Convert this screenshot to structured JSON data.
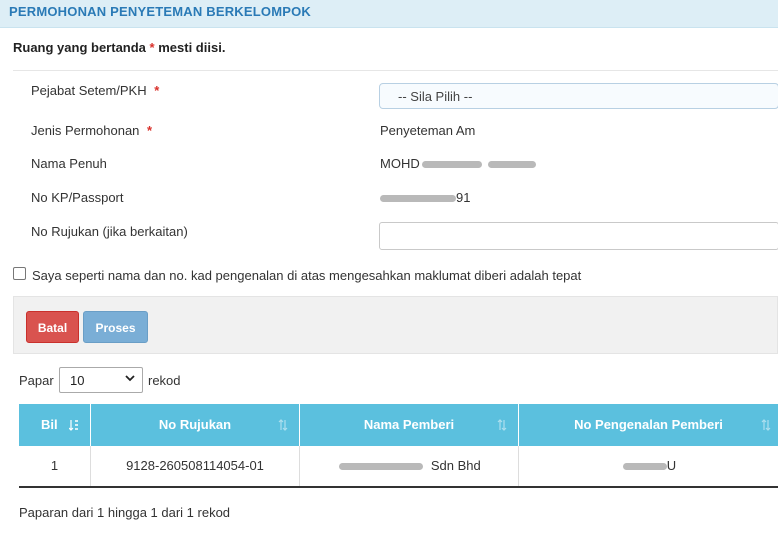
{
  "header": {
    "title": "PERMOHONAN PENYETEMAN BERKELOMPOK"
  },
  "required_note": {
    "prefix": "Ruang yang bertanda",
    "star": "*",
    "suffix": "mesti diisi."
  },
  "form": {
    "pejabat": {
      "label": "Pejabat Setem/PKH",
      "star": "*",
      "selected": "-- Sila Pilih --"
    },
    "jenis": {
      "label": "Jenis Permohonan",
      "star": "*",
      "value": "Penyeteman Am"
    },
    "nama": {
      "label": "Nama Penuh",
      "value_visible": "MOHD"
    },
    "kp": {
      "label": "No KP/Passport",
      "value_visible": "91"
    },
    "rujukan": {
      "label": "No Rujukan (jika berkaitan)",
      "value": ""
    }
  },
  "declaration": {
    "checked": false,
    "label": "Saya seperti nama dan no. kad pengenalan di atas mengesahkan maklumat diberi adalah tepat"
  },
  "buttons": {
    "batal": "Batal",
    "proses": "Proses"
  },
  "colors": {
    "batal": "#d9534f",
    "proses": "#7aaed6",
    "table_header": "#5bc0de",
    "header_title": "#2a7ab6",
    "required": "#d9302a"
  },
  "pagination": {
    "prefix": "Papar",
    "page_size": "10",
    "suffix": "rekod"
  },
  "table": {
    "columns": [
      "Bil",
      "No Rujukan",
      "Nama Pemberi",
      "No Pengenalan Pemberi"
    ],
    "rows": [
      {
        "bil": "1",
        "no_rujukan": "9128-260508114054-01",
        "nama_pemberi_visible": "Sdn Bhd",
        "no_pengenalan_visible": "U"
      }
    ]
  },
  "footer": {
    "summary": "Paparan dari 1 hingga 1 dari 1 rekod"
  },
  "icons": [
    "sort-icon",
    "chevron-down-icon"
  ]
}
